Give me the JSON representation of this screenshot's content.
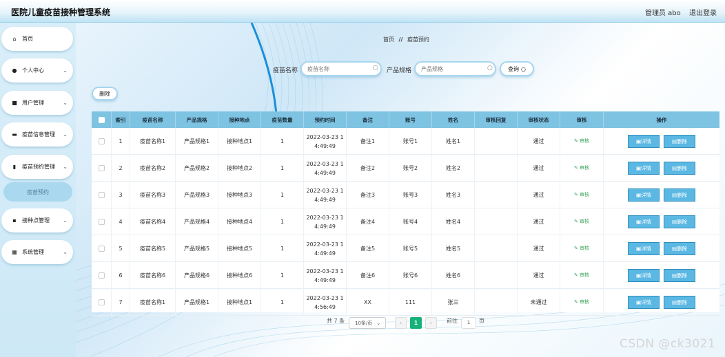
{
  "header": {
    "title": "医院儿童疫苗接种管理系统",
    "admin": "管理员 abo",
    "logout": "退出登录"
  },
  "sidebar": {
    "items": [
      {
        "label": "首页",
        "icon": "home-icon",
        "glyph": "⌂"
      },
      {
        "label": "个人中心",
        "icon": "user-icon",
        "glyph": "●"
      },
      {
        "label": "用户管理",
        "icon": "briefcase-icon",
        "glyph": "■"
      },
      {
        "label": "疫苗信息管理",
        "icon": "comment-icon",
        "glyph": "▬"
      },
      {
        "label": "疫苗预约管理",
        "icon": "chart-icon",
        "glyph": "▮"
      },
      {
        "label": "接种点管理",
        "icon": "clipboard-icon",
        "glyph": "▪"
      },
      {
        "label": "系统管理",
        "icon": "grid-icon",
        "glyph": "▦"
      }
    ],
    "submenu_active": "疫苗预约"
  },
  "breadcrumb": {
    "home": "首页",
    "separator": "//",
    "current": "疫苗预约"
  },
  "search": {
    "name_label": "疫苗名称",
    "name_placeholder": "疫苗名称",
    "spec_label": "产品规格",
    "spec_placeholder": "产品规格",
    "query_button": "查询"
  },
  "toolbar": {
    "delete_label": "删除"
  },
  "table": {
    "headers": [
      "索引",
      "疫苗名称",
      "产品规格",
      "接种地点",
      "疫苗数量",
      "预约时间",
      "备注",
      "账号",
      "姓名",
      "审核回复",
      "审核状态",
      "审核",
      "操作"
    ],
    "audit_label": "审核",
    "detail_label": "详情",
    "delete_label": "删除",
    "rows": [
      {
        "index": "1",
        "name": "疫苗名称1",
        "spec": "产品规格1",
        "place": "接种地点1",
        "qty": "1",
        "time1": "2022-03-23 1",
        "time2": "4:49:49",
        "note": "备注1",
        "account": "账号1",
        "person": "姓名1",
        "reply": "",
        "status": "通过"
      },
      {
        "index": "2",
        "name": "疫苗名称2",
        "spec": "产品规格2",
        "place": "接种地点2",
        "qty": "1",
        "time1": "2022-03-23 1",
        "time2": "4:49:49",
        "note": "备注2",
        "account": "账号2",
        "person": "姓名2",
        "reply": "",
        "status": "通过"
      },
      {
        "index": "3",
        "name": "疫苗名称3",
        "spec": "产品规格3",
        "place": "接种地点3",
        "qty": "1",
        "time1": "2022-03-23 1",
        "time2": "4:49:49",
        "note": "备注3",
        "account": "账号3",
        "person": "姓名3",
        "reply": "",
        "status": "通过"
      },
      {
        "index": "4",
        "name": "疫苗名称4",
        "spec": "产品规格4",
        "place": "接种地点4",
        "qty": "1",
        "time1": "2022-03-23 1",
        "time2": "4:49:49",
        "note": "备注4",
        "account": "账号4",
        "person": "姓名4",
        "reply": "",
        "status": "通过"
      },
      {
        "index": "5",
        "name": "疫苗名称5",
        "spec": "产品规格5",
        "place": "接种地点5",
        "qty": "1",
        "time1": "2022-03-23 1",
        "time2": "4:49:49",
        "note": "备注5",
        "account": "账号5",
        "person": "姓名5",
        "reply": "",
        "status": "通过"
      },
      {
        "index": "6",
        "name": "疫苗名称6",
        "spec": "产品规格6",
        "place": "接种地点6",
        "qty": "1",
        "time1": "2022-03-23 1",
        "time2": "4:49:49",
        "note": "备注6",
        "account": "账号6",
        "person": "姓名6",
        "reply": "",
        "status": "通过"
      },
      {
        "index": "7",
        "name": "疫苗名称1",
        "spec": "产品规格1",
        "place": "接种地点1",
        "qty": "1",
        "time1": "2022-03-23 1",
        "time2": "4:56:49",
        "note": "XX",
        "account": "111",
        "person": "张三",
        "reply": "",
        "status": "未通过"
      }
    ]
  },
  "pagination": {
    "total": "共 7 条",
    "page_size": "10条/页",
    "current_page": "1",
    "goto_label": "前往",
    "goto_value": "1",
    "page_unit": "页"
  },
  "watermark": "CSDN @ck3021"
}
